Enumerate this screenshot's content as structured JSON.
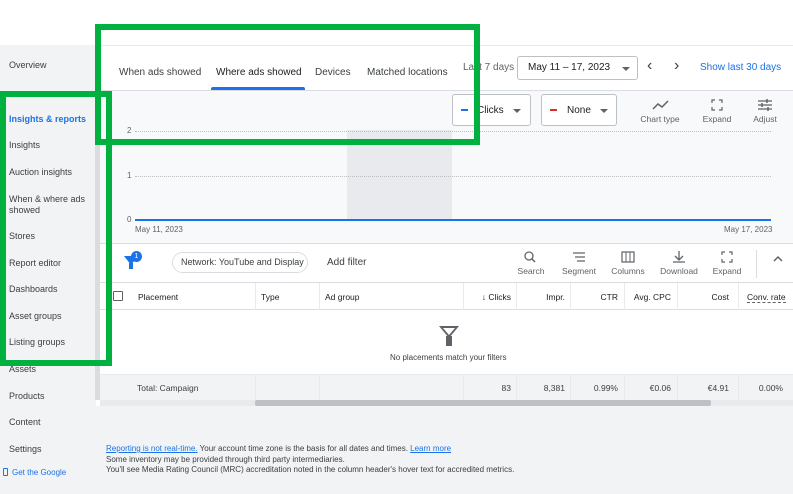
{
  "leftnav": {
    "items": [
      {
        "label": "Overview",
        "active": false
      },
      {
        "label": "Insights & reports",
        "active": true
      },
      {
        "label": "Insights",
        "active": false
      },
      {
        "label": "Auction insights",
        "active": false
      },
      {
        "label": "When & where ads showed",
        "active": false
      },
      {
        "label": "Stores",
        "active": false
      },
      {
        "label": "Report editor",
        "active": false
      },
      {
        "label": "Dashboards",
        "active": false
      },
      {
        "label": "Asset groups",
        "active": false
      },
      {
        "label": "Listing groups",
        "active": false
      },
      {
        "label": "Assets",
        "active": false
      },
      {
        "label": "Products",
        "active": false
      },
      {
        "label": "Content",
        "active": false
      },
      {
        "label": "Settings",
        "active": false
      }
    ],
    "get_google": "Get the Google"
  },
  "tabs": [
    "When ads showed",
    "Where ads showed",
    "Devices",
    "Matched locations"
  ],
  "active_tab": "Where ads showed",
  "date": {
    "label": "Last 7 days",
    "range": "May 11 – 17, 2023",
    "show_last": "Show last 30 days"
  },
  "chart_toolbar": {
    "metric1": "Clicks",
    "metric1_color": "#1a73e8",
    "metric2": "None",
    "metric2_color": "#d93025",
    "chart_type": "Chart type",
    "expand": "Expand",
    "adjust": "Adjust"
  },
  "chart_data": {
    "type": "line",
    "x": [
      "May 11, 2023",
      "May 17, 2023"
    ],
    "series": [
      {
        "name": "Clicks",
        "values": [
          0,
          0
        ]
      }
    ],
    "yticks": [
      "2",
      "1",
      "0"
    ],
    "ylim": [
      0,
      2
    ],
    "xlabels": [
      "May 11, 2023",
      "May 17, 2023"
    ],
    "grid": true
  },
  "table_toolbar": {
    "filter_count": "1",
    "network_chip": "Network: YouTube and Display",
    "add_filter": "Add filter",
    "search": "Search",
    "segment": "Segment",
    "columns": "Columns",
    "download": "Download",
    "expand": "Expand"
  },
  "table": {
    "headers": [
      "Placement",
      "Type",
      "Ad group",
      "Clicks",
      "Impr.",
      "CTR",
      "Avg. CPC",
      "Cost",
      "Conv. rate"
    ],
    "empty_message": "No placements match your filters",
    "total_row": {
      "label": "Total: Campaign",
      "clicks": "83",
      "impr": "8,381",
      "ctr": "0.99%",
      "avg_cpc": "€0.06",
      "cost": "€4.91",
      "conv_rate": "0.00%"
    }
  },
  "footer": {
    "reporting_link": "Reporting is not real-time.",
    "line1_rest": " Your account time zone is the basis for all dates and times. ",
    "learn_more": "Learn more",
    "line2": "Some inventory may be provided through third party intermediaries.",
    "line3": "You'll see Media Rating Council (MRC) accreditation noted in the column header's hover text for accredited metrics."
  },
  "highlight_color": "#00b140"
}
